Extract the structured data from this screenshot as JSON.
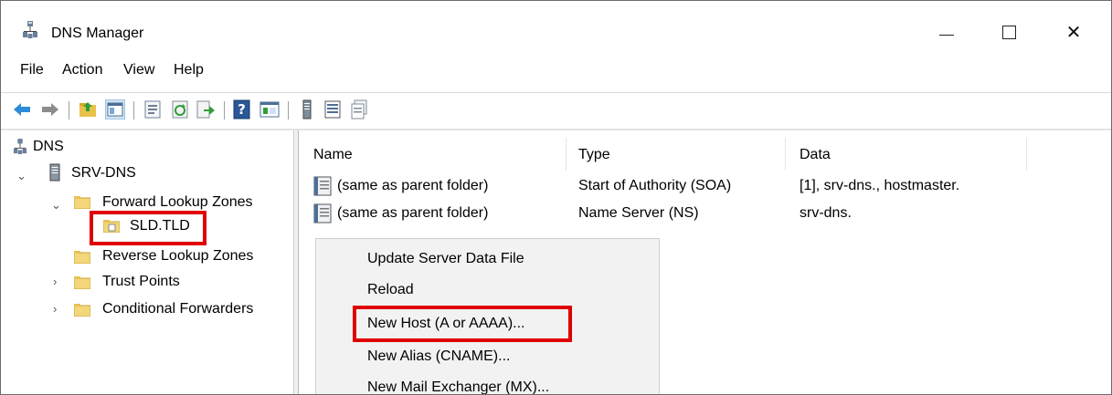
{
  "window": {
    "title": "DNS Manager",
    "controls": {
      "minimize": "minimize",
      "maximize": "maximize",
      "close": "✕"
    }
  },
  "menu": [
    "File",
    "Action",
    "View",
    "Help"
  ],
  "toolbar": {
    "icons": [
      "back-arrow-icon",
      "forward-arrow-icon",
      "up-folder-icon",
      "show-tree-icon",
      "properties-icon",
      "refresh-icon",
      "export-icon",
      "help-icon",
      "console-icon",
      "server-icon",
      "list-icon",
      "records-icon"
    ]
  },
  "tree": {
    "root": "DNS",
    "server": "SRV-DNS",
    "forward_zones": "Forward Lookup Zones",
    "zone": "SLD.TLD",
    "reverse_zones": "Reverse Lookup Zones",
    "trust_points": "Trust Points",
    "conditional_forwarders": "Conditional Forwarders"
  },
  "list": {
    "columns": [
      "Name",
      "Type",
      "Data"
    ],
    "rows": [
      {
        "name": "(same as parent folder)",
        "type": "Start of Authority (SOA)",
        "data": "[1], srv-dns., hostmaster."
      },
      {
        "name": "(same as parent folder)",
        "type": "Name Server (NS)",
        "data": "srv-dns."
      }
    ]
  },
  "context_menu": {
    "items": [
      "Update Server Data File",
      "Reload",
      "New Host (A or AAAA)...",
      "New Alias (CNAME)...",
      "New Mail Exchanger (MX)..."
    ]
  },
  "colors": {
    "highlight": "#e00000",
    "folder": "#f3d77a",
    "menu_bg": "#f2f2f2"
  }
}
